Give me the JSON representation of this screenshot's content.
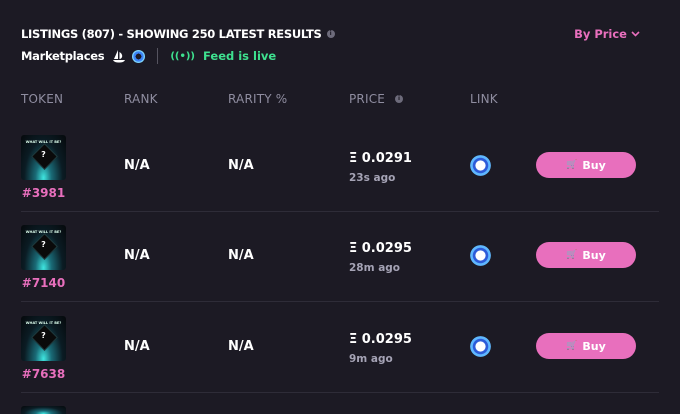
{
  "header": {
    "title": "LISTINGS (807) - SHOWING 250 LATEST RESULTS",
    "sort_label": "By Price"
  },
  "marketplaces": {
    "label": "Marketplaces",
    "feed_status": "Feed is live"
  },
  "columns": {
    "token": "TOKEN",
    "rank": "RANK",
    "rarity": "RARITY %",
    "price": "PRICE",
    "link": "LINK"
  },
  "thumbnail_text": "WHAT WILL IT BE?",
  "listings": [
    {
      "token_id": "#3981",
      "rank": "N/A",
      "rarity": "N/A",
      "price": "Ξ 0.0291",
      "ago": "23s ago",
      "buy_label": "Buy"
    },
    {
      "token_id": "#7140",
      "rank": "N/A",
      "rarity": "N/A",
      "price": "Ξ 0.0295",
      "ago": "28m ago",
      "buy_label": "Buy"
    },
    {
      "token_id": "#7638",
      "rank": "N/A",
      "rarity": "N/A",
      "price": "Ξ 0.0295",
      "ago": "9m ago",
      "buy_label": "Buy"
    }
  ],
  "colors": {
    "background": "#1c1a24",
    "accent_pink": "#e86fbd",
    "live_green": "#3ee08f",
    "muted_text": "#8f8da0"
  }
}
